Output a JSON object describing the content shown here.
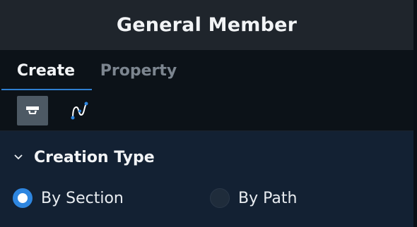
{
  "window": {
    "title": "General Member"
  },
  "tabs": [
    {
      "label": "Create",
      "active": true
    },
    {
      "label": "Property",
      "active": false
    }
  ],
  "toolbar": {
    "tools": [
      {
        "icon": "section-shape-icon",
        "selected": true
      },
      {
        "icon": "path-curve-icon",
        "selected": false
      }
    ]
  },
  "creation_type": {
    "heading": "Creation Type",
    "expanded": true,
    "options": [
      {
        "label": "By Section",
        "selected": true
      },
      {
        "label": "By Path",
        "selected": false
      }
    ]
  },
  "colors": {
    "accent": "#2e86e0",
    "tab_underline": "#2f7fd1",
    "title_bar_bg": "#1f252c",
    "panel_bg": "#0c1218",
    "section_bg": "#132133"
  }
}
